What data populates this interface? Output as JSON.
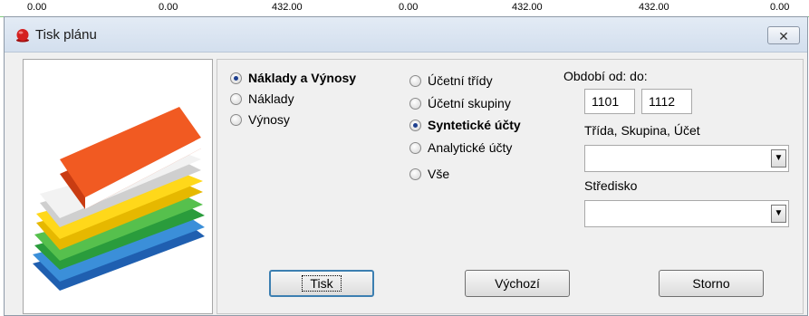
{
  "background_values": [
    "0.00",
    "0.00",
    "432.00",
    "0.00",
    "432.00",
    "432.00",
    "0.00"
  ],
  "window": {
    "title": "Tisk plánu",
    "close_glyph": "✕"
  },
  "type_group": {
    "options": [
      {
        "label": "Náklady a Výnosy",
        "checked": true
      },
      {
        "label": "Náklady",
        "checked": false
      },
      {
        "label": "Výnosy",
        "checked": false
      }
    ]
  },
  "level_group": {
    "options": [
      {
        "label": "Účetní třídy",
        "checked": false
      },
      {
        "label": "Účetní skupiny",
        "checked": false
      },
      {
        "label": "Syntetické účty",
        "checked": true
      },
      {
        "label": "Analytické účty",
        "checked": false
      },
      {
        "label": "Vše",
        "checked": false
      }
    ]
  },
  "period": {
    "label": "Období od: do:",
    "from": "1101",
    "to": "1112"
  },
  "class_filter": {
    "label": "Třída, Skupina, Účet",
    "value": ""
  },
  "center_filter": {
    "label": "Středisko",
    "value": ""
  },
  "buttons": {
    "print": "Tisk",
    "default": "Výchozí",
    "cancel": "Storno"
  },
  "icons": {
    "title": "red-dot-icon",
    "close": "close-icon",
    "image": "books-stack-icon",
    "dropdown": "chevron-down-icon"
  },
  "colors": {
    "title_icon": "#d42020",
    "book_top": "#f15a22",
    "radio_checked": "#1d3f8f"
  }
}
